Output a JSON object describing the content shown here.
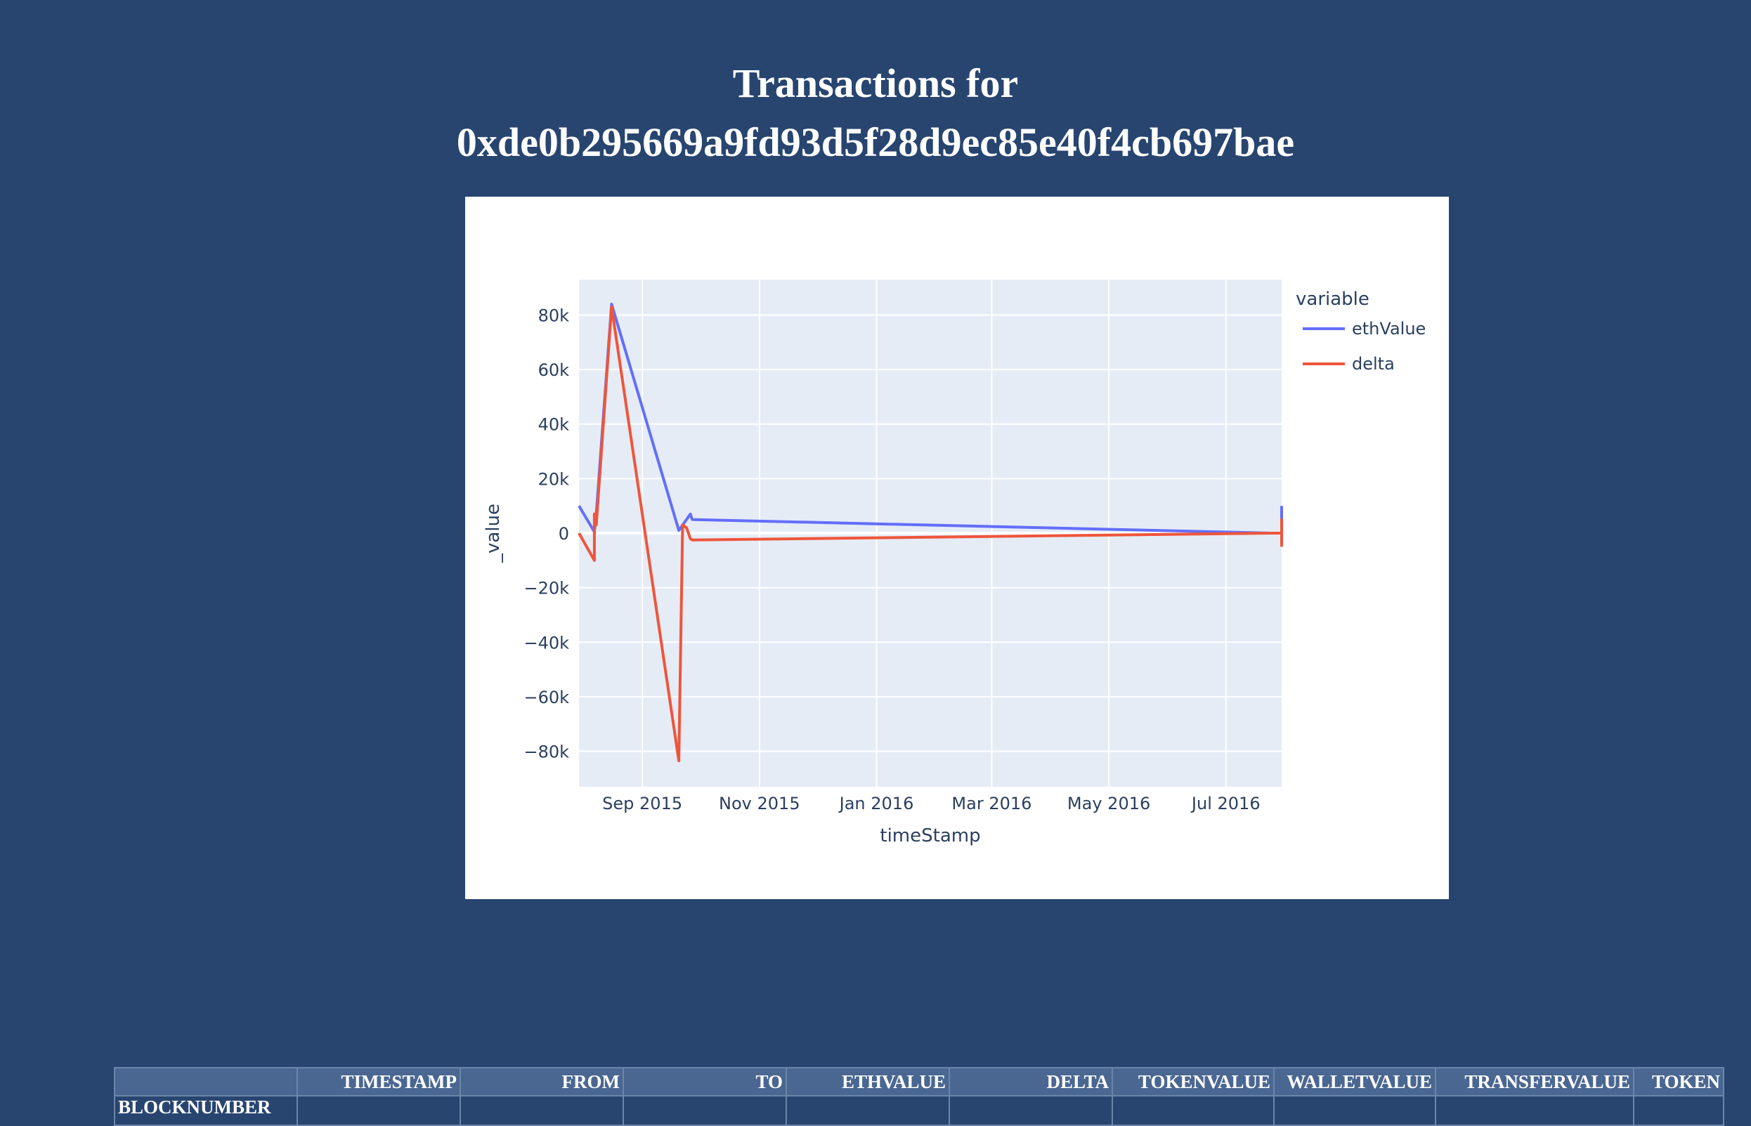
{
  "page": {
    "title_line1": "Transactions for",
    "title_line2": "0xde0b295669a9fd93d5f28d9ec85e40f4cb697bae",
    "background": "#284570"
  },
  "chart_data": {
    "type": "line",
    "title": "",
    "xlabel": "timeStamp",
    "ylabel": "_value",
    "legend_title": "variable",
    "legend_position": "right",
    "grid": true,
    "x_range": [
      "2015-07-30",
      "2016-07-30"
    ],
    "ylim": [
      -93000,
      93000
    ],
    "x_ticks": [
      {
        "date": "2015-09-01",
        "label": "Sep 2015"
      },
      {
        "date": "2015-11-01",
        "label": "Nov 2015"
      },
      {
        "date": "2016-01-01",
        "label": "Jan 2016"
      },
      {
        "date": "2016-03-01",
        "label": "Mar 2016"
      },
      {
        "date": "2016-05-01",
        "label": "May 2016"
      },
      {
        "date": "2016-07-01",
        "label": "Jul 2016"
      }
    ],
    "y_ticks": [
      {
        "value": 80000,
        "label": "80k"
      },
      {
        "value": 60000,
        "label": "60k"
      },
      {
        "value": 40000,
        "label": "40k"
      },
      {
        "value": 20000,
        "label": "20k"
      },
      {
        "value": 0,
        "label": "0"
      },
      {
        "value": -20000,
        "label": "−20k"
      },
      {
        "value": -40000,
        "label": "−40k"
      },
      {
        "value": -60000,
        "label": "−60k"
      },
      {
        "value": -80000,
        "label": "−80k"
      }
    ],
    "series": [
      {
        "name": "ethValue",
        "color": "#636efa",
        "x": [
          "2015-07-30",
          "2015-08-07",
          "2015-08-08",
          "2015-08-16",
          "2015-09-20",
          "2015-09-24",
          "2015-09-26",
          "2015-09-27",
          "2016-07-25",
          "2016-07-30",
          "2016-07-30"
        ],
        "y": [
          10000,
          500,
          7000,
          84000,
          1000,
          5000,
          7000,
          5000,
          0,
          0,
          10000
        ]
      },
      {
        "name": "delta",
        "color": "#ef553b",
        "x": [
          "2015-07-30",
          "2015-08-07",
          "2015-08-07",
          "2015-08-08",
          "2015-08-16",
          "2015-09-20",
          "2015-09-22",
          "2015-09-24",
          "2015-09-26",
          "2015-09-27",
          "2016-07-25",
          "2016-07-30",
          "2016-07-30",
          "2016-07-30"
        ],
        "y": [
          0,
          -10000,
          7000,
          3000,
          83000,
          -83500,
          3000,
          2000,
          -2000,
          -2500,
          0,
          0,
          5000,
          -5000
        ]
      }
    ]
  },
  "table": {
    "columns": [
      "",
      "TIMESTAMP",
      "FROM",
      "TO",
      "ETHVALUE",
      "DELTA",
      "TOKENVALUE",
      "WALLETVALUE",
      "TRANSFERVALUE",
      "TOKEN"
    ],
    "index_name": "BLOCKNUMBER"
  }
}
